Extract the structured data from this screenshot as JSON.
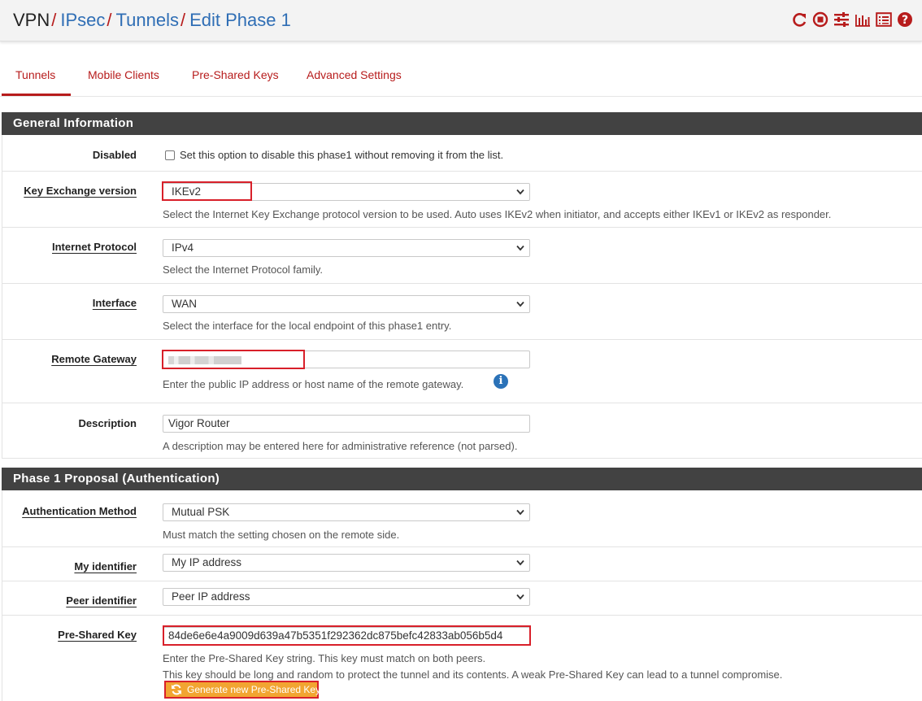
{
  "breadcrumb": [
    "VPN",
    "IPsec",
    "Tunnels",
    "Edit Phase 1"
  ],
  "header_icons": [
    "reload-icon",
    "stop-icon",
    "settings-sliders-icon",
    "chart-icon",
    "list-icon",
    "help-icon"
  ],
  "tabs": [
    {
      "label": "Tunnels",
      "active": true
    },
    {
      "label": "Mobile Clients"
    },
    {
      "label": "Pre-Shared Keys"
    },
    {
      "label": "Advanced Settings"
    }
  ],
  "general": {
    "heading": "General Information",
    "disabled": {
      "label": "Disabled",
      "text": "Set this option to disable this phase1 without removing it from the list."
    },
    "key_exchange": {
      "label": "Key Exchange version",
      "value": "IKEv2",
      "help": "Select the Internet Key Exchange protocol version to be used. Auto uses IKEv2 when initiator, and accepts either IKEv1 or IKEv2 as responder."
    },
    "internet_protocol": {
      "label": "Internet Protocol",
      "value": "IPv4",
      "help": "Select the Internet Protocol family."
    },
    "interface": {
      "label": "Interface",
      "value": "WAN",
      "help": "Select the interface for the local endpoint of this phase1 entry."
    },
    "remote_gateway": {
      "label": "Remote Gateway",
      "help": "Enter the public IP address or host name of the remote gateway."
    },
    "description": {
      "label": "Description",
      "value": "Vigor Router",
      "help": "A description may be entered here for administrative reference (not parsed)."
    }
  },
  "phase1": {
    "heading": "Phase 1 Proposal (Authentication)",
    "auth_method": {
      "label": "Authentication Method",
      "value": "Mutual PSK",
      "help": "Must match the setting chosen on the remote side."
    },
    "my_identifier": {
      "label": "My identifier",
      "value": "My IP address"
    },
    "peer_identifier": {
      "label": "Peer identifier",
      "value": "Peer IP address"
    },
    "psk": {
      "label": "Pre-Shared Key",
      "value": "84de6e6e4a9009d639a47b5351f292362dc875befc42833ab056b5d4",
      "help1": "Enter the Pre-Shared Key string. This key must match on both peers.",
      "help2": "This key should be long and random to protect the tunnel and its contents. A weak Pre-Shared Key can lead to a tunnel compromise.",
      "generate_label": "Generate new Pre-Shared Key"
    }
  },
  "colors": {
    "accent": "#b71c1c",
    "link": "#2f6eb5",
    "heading_bg": "#424242",
    "highlight": "#d8202a",
    "button": "#f2a531"
  }
}
